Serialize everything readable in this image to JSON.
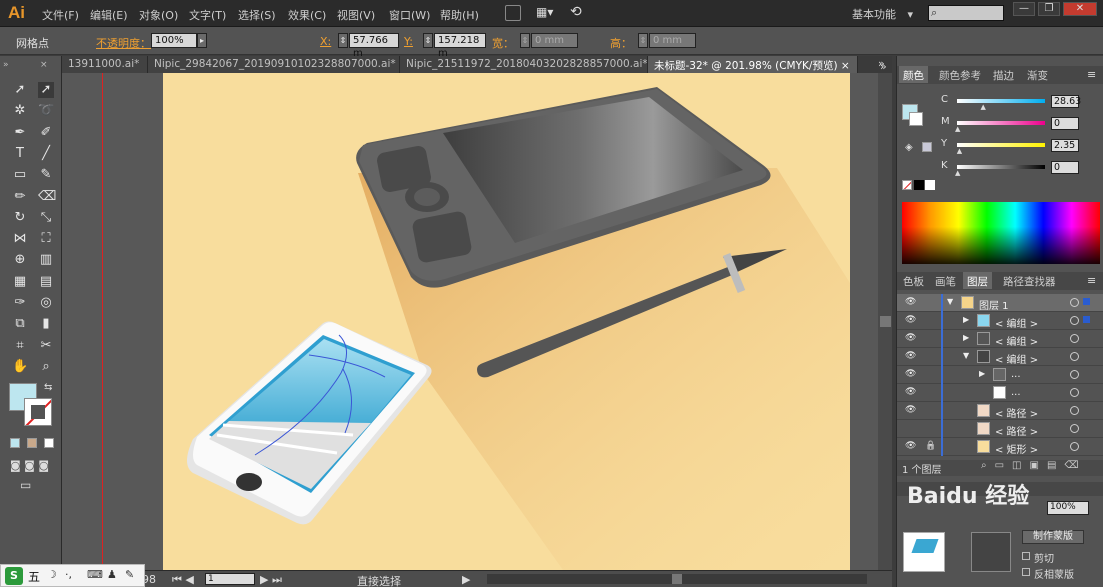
{
  "app": {
    "logo": "Ai"
  },
  "menu": [
    "文件(F)",
    "编辑(E)",
    "对象(O)",
    "文字(T)",
    "选择(S)",
    "效果(C)",
    "视图(V)",
    "窗口(W)",
    "帮助(H)"
  ],
  "workspace": {
    "label": "基本功能",
    "arrow": "▾"
  },
  "window_buttons": [
    "—",
    "❐",
    "✕"
  ],
  "control": {
    "selection": "网格点",
    "opacity_label": "不透明度：",
    "opacity_value": "100%",
    "x_label": "X:",
    "x_value": "57.766 m",
    "y_label": "Y:",
    "y_value": "157.218 m",
    "w_label": "宽：",
    "w_value": "0 mm",
    "h_label": "高：",
    "h_value": "0 mm"
  },
  "tabs": [
    "13911000.ai*",
    "Nipic_29842067_20190910102328807000.ai*",
    "Nipic_21511972_20180403202828857000.ai*",
    "未标题-32* @ 201.98% (CMYK/预览)"
  ],
  "tab_close": "×",
  "panels": {
    "color_tabs": [
      "颜色",
      "颜色参考",
      "描边",
      "渐变"
    ],
    "color_sliders": [
      {
        "label": "C",
        "value": "28.63",
        "pos": 0.29,
        "grad": "linear-gradient(90deg,#fff,#00aeef)"
      },
      {
        "label": "M",
        "value": "0",
        "pos": 0,
        "grad": "linear-gradient(90deg,#fff,#ec008c)"
      },
      {
        "label": "Y",
        "value": "2.35",
        "pos": 0.02,
        "grad": "linear-gradient(90deg,#fff,#fff200)"
      },
      {
        "label": "K",
        "value": "0",
        "pos": 0,
        "grad": "linear-gradient(90deg,#fff,#000)"
      }
    ],
    "layers_tabs": [
      "色板",
      "画笔",
      "图层",
      "路径查找器"
    ],
    "layers": [
      {
        "name": "图层 1",
        "indent": 0,
        "arrow": "▼",
        "eye": true,
        "lock": false,
        "square": true,
        "sel": true
      },
      {
        "name": "< 编组 >",
        "indent": 1,
        "arrow": "▶",
        "eye": true,
        "lock": false,
        "square": true,
        "sel": false
      },
      {
        "name": "< 编组 >",
        "indent": 1,
        "arrow": "▶",
        "eye": true,
        "lock": false,
        "square": false,
        "sel": false
      },
      {
        "name": "< 编组 >",
        "indent": 1,
        "arrow": "▼",
        "eye": true,
        "lock": false,
        "square": false,
        "sel": false
      },
      {
        "name": "...",
        "indent": 2,
        "arrow": "▶",
        "eye": true,
        "lock": false,
        "square": false,
        "sel": false
      },
      {
        "name": "...",
        "indent": 2,
        "arrow": "",
        "eye": true,
        "lock": false,
        "square": false,
        "sel": false
      },
      {
        "name": "< 路径 >",
        "indent": 1,
        "arrow": "",
        "eye": true,
        "lock": false,
        "square": false,
        "sel": false
      },
      {
        "name": "< 路径 >",
        "indent": 1,
        "arrow": "",
        "eye": false,
        "lock": false,
        "square": false,
        "sel": false
      },
      {
        "name": "< 矩形 >",
        "indent": 1,
        "arrow": "",
        "eye": true,
        "lock": true,
        "square": false,
        "sel": false
      }
    ],
    "layer_count": "1 个图层",
    "mask_button": "制作蒙版",
    "clip_label": "剪切",
    "invert_label": "反相蒙版",
    "opacity_field": "100%",
    "watermark": "Baidu 经验"
  },
  "status": {
    "zoom_value": "1",
    "tool_name": "直接选择",
    "page_prefix": "98"
  },
  "taskbar": {
    "ime": "五",
    "items": [
      "S",
      "五",
      "☽",
      "·,",
      "⌨",
      "♟",
      "✎"
    ]
  }
}
